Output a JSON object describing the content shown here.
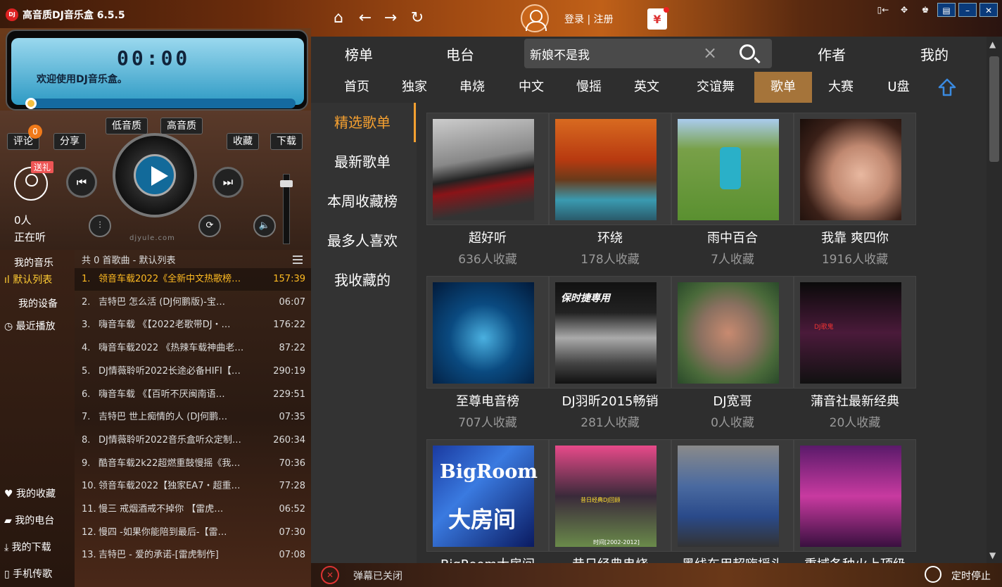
{
  "app": {
    "title": "高音质DJ音乐盒 6.5.5",
    "icon_text": "DJ"
  },
  "topbar": {
    "login": "登录 | 注册",
    "gift": "¥"
  },
  "player": {
    "time": "00:00",
    "welcome": "欢迎使用DJ音乐盒。",
    "low_quality": "低音质",
    "high_quality": "高音质",
    "comment": "评论",
    "comment_count": "0",
    "share": "分享",
    "collect": "收藏",
    "download": "下载",
    "gift_tag": "送礼",
    "listeners": "0人",
    "listening": "正在听",
    "site": "djyule.com",
    "progress": 0.0,
    "volume": 0.95
  },
  "sidenav": {
    "items": [
      "我的音乐",
      "默认列表",
      "我的设备",
      "最近播放",
      "我的收藏",
      "我的电台",
      "我的下载",
      "手机传歌"
    ]
  },
  "playlist": {
    "header": "共 0 首歌曲 - 默认列表",
    "tracks": [
      {
        "n": "1.",
        "name": "领音车载2022《全新中文热歌榜…",
        "dur": "157:39"
      },
      {
        "n": "2.",
        "name": "吉特巴  怎么活 (DJ何鹏版)-宝…",
        "dur": "06:07"
      },
      {
        "n": "3.",
        "name": "嗨音车载 《【2022老歌带DJ・…",
        "dur": "176:22"
      },
      {
        "n": "4.",
        "name": "嗨音车载2022 《热辣车载神曲老…",
        "dur": "87:22"
      },
      {
        "n": "5.",
        "name": "DJ情薇聆听2022长途必备HIFI【…",
        "dur": "290:19"
      },
      {
        "n": "6.",
        "name": "嗨音车载 《【百听不厌闽南语…",
        "dur": "229:51"
      },
      {
        "n": "7.",
        "name": "吉特巴  世上痴情的人 (DJ何鹏…",
        "dur": "07:35"
      },
      {
        "n": "8.",
        "name": "DJ情薇聆听2022音乐盒听众定制…",
        "dur": "260:34"
      },
      {
        "n": "9.",
        "name": "酷音车载2k22超燃重鼓慢摇《我…",
        "dur": "70:36"
      },
      {
        "n": "10.",
        "name": "领音车载2022【独家EA7・超重…",
        "dur": "77:28"
      },
      {
        "n": "11.",
        "name": "慢三  戒烟酒戒不掉你 【雷虎…",
        "dur": "06:52"
      },
      {
        "n": "12.",
        "name": "慢四  -如果你能陪到最后-【雷…",
        "dur": "07:30"
      },
      {
        "n": "13.",
        "name": "吉特巴  - 爱的承诺-[雷虎制作]",
        "dur": "07:08"
      }
    ]
  },
  "topnav": {
    "items": [
      "榜单",
      "电台",
      "作者",
      "我的"
    ]
  },
  "search": {
    "value": "新娘不是我",
    "clear": "×"
  },
  "catnav": {
    "items": [
      "首页",
      "独家",
      "串烧",
      "中文",
      "慢摇",
      "英文",
      "交谊舞",
      "歌单",
      "大赛",
      "U盘"
    ]
  },
  "subnav": {
    "items": [
      "精选歌单",
      "最新歌单",
      "本周收藏榜",
      "最多人喜欢",
      "我收藏的"
    ]
  },
  "cards": [
    {
      "title": "超好听",
      "count": "636人收藏"
    },
    {
      "title": "环绕",
      "count": "178人收藏"
    },
    {
      "title": "雨中百合",
      "count": "7人收藏"
    },
    {
      "title": "我靠 爽四你",
      "count": "1916人收藏"
    },
    {
      "title": "至尊电音榜",
      "count": "707人收藏"
    },
    {
      "title": "DJ羽昕2015畅销",
      "count": "281人收藏"
    },
    {
      "title": "DJ宽哥",
      "count": "0人收藏"
    },
    {
      "title": "蒲音社最新经典",
      "count": "20人收藏"
    },
    {
      "title": "BigRoom大房间",
      "count": ""
    },
    {
      "title": "昔日经典串烧",
      "count": ""
    },
    {
      "title": "黑线车用超嗨摇头",
      "count": ""
    },
    {
      "title": "重域各种火上顶级",
      "count": ""
    }
  ],
  "thumbtext": {
    "c9a": "BigRoom",
    "c9b": "大房间",
    "c6": "保时捷専用",
    "c10": "昔日经典DJ回顾",
    "c10b": "时间[2002-2012]",
    "c8": "DJ歌鬼"
  },
  "status": {
    "danmaku": "弹幕已关闭",
    "timer": "定时停止"
  },
  "colors": {
    "accent": "#f5a030",
    "active_cat": "#a5743a",
    "current_track": "#ffbb22"
  }
}
